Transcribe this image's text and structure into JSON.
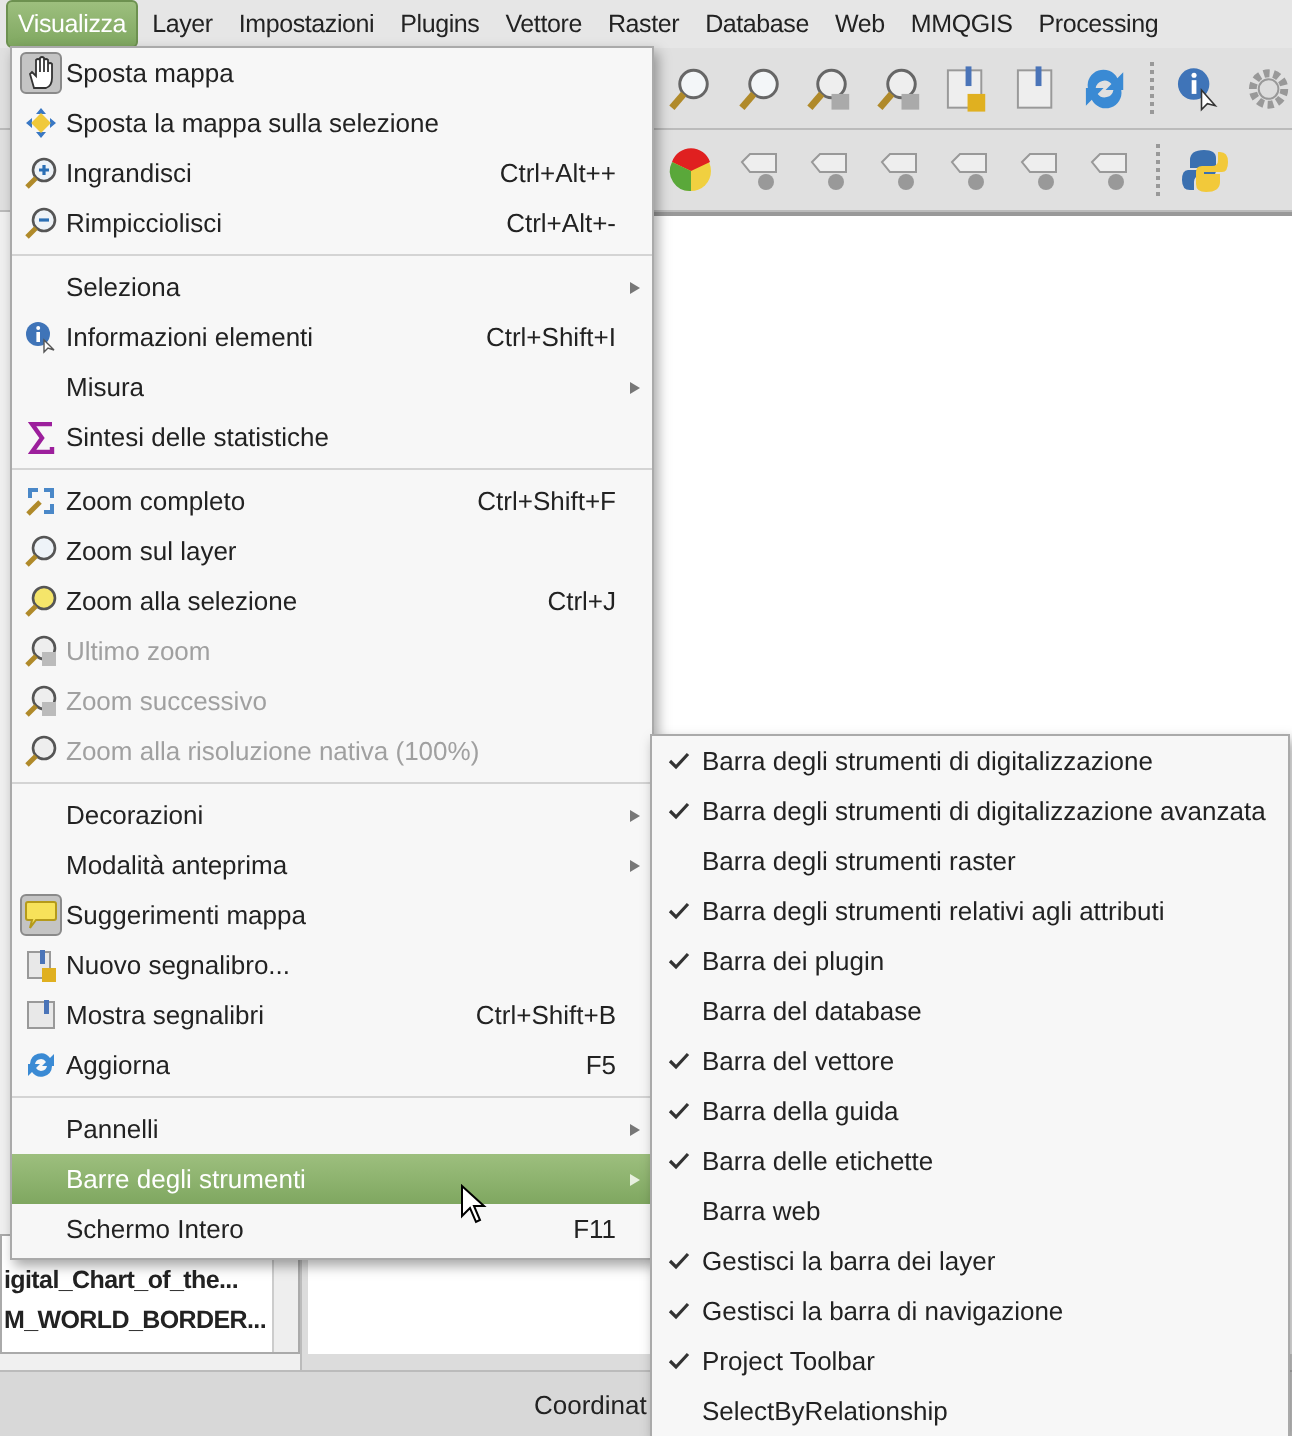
{
  "menubar": [
    {
      "label": "Visualizza",
      "selected": true
    },
    {
      "label": "Layer",
      "selected": false
    },
    {
      "label": "Impostazioni",
      "selected": false
    },
    {
      "label": "Plugins",
      "selected": false
    },
    {
      "label": "Vettore",
      "selected": false
    },
    {
      "label": "Raster",
      "selected": false
    },
    {
      "label": "Database",
      "selected": false
    },
    {
      "label": "Web",
      "selected": false
    },
    {
      "label": "MMQGIS",
      "selected": false
    },
    {
      "label": "Processing",
      "selected": false
    }
  ],
  "layers": [
    {
      "label": "igital_Chart_of_the..."
    },
    {
      "label": "M_WORLD_BORDER..."
    }
  ],
  "status_bar": {
    "label": "Coordinat"
  },
  "menu": {
    "sections": [
      {
        "items": [
          {
            "kind": "action",
            "label": "Sposta mappa",
            "checked": true,
            "disabled": false,
            "selected": false
          },
          {
            "kind": "action",
            "label": "Sposta la mappa sulla selezione",
            "checked": false,
            "disabled": false,
            "selected": false
          },
          {
            "kind": "action",
            "label": "Ingrandisci",
            "shortcut": "Ctrl+Alt++",
            "checked": false,
            "disabled": false,
            "selected": false
          },
          {
            "kind": "action",
            "label": "Rimpicciolisci",
            "shortcut": "Ctrl+Alt+-",
            "checked": false,
            "disabled": false,
            "selected": false
          }
        ]
      },
      {
        "items": [
          {
            "kind": "submenu",
            "label": "Seleziona",
            "checked": false,
            "disabled": false,
            "selected": false
          },
          {
            "kind": "action",
            "label": "Informazioni elementi",
            "shortcut": "Ctrl+Shift+I",
            "checked": false,
            "disabled": false,
            "selected": false
          },
          {
            "kind": "submenu",
            "label": "Misura",
            "checked": false,
            "disabled": false,
            "selected": false
          },
          {
            "kind": "action",
            "label": "Sintesi delle statistiche",
            "checked": false,
            "disabled": false,
            "selected": false
          }
        ]
      },
      {
        "items": [
          {
            "kind": "action",
            "label": "Zoom completo",
            "shortcut": "Ctrl+Shift+F",
            "checked": false,
            "disabled": false,
            "selected": false
          },
          {
            "kind": "action",
            "label": "Zoom sul layer",
            "checked": false,
            "disabled": false,
            "selected": false
          },
          {
            "kind": "action",
            "label": "Zoom alla selezione",
            "shortcut": "Ctrl+J",
            "checked": false,
            "disabled": false,
            "selected": false
          },
          {
            "kind": "action",
            "label": "Ultimo zoom",
            "checked": false,
            "disabled": true,
            "selected": false
          },
          {
            "kind": "action",
            "label": "Zoom successivo",
            "checked": false,
            "disabled": true,
            "selected": false
          },
          {
            "kind": "action",
            "label": "Zoom alla risoluzione nativa (100%)",
            "checked": false,
            "disabled": true,
            "selected": false
          }
        ]
      },
      {
        "items": [
          {
            "kind": "submenu",
            "label": "Decorazioni",
            "checked": false,
            "disabled": false,
            "selected": false
          },
          {
            "kind": "submenu",
            "label": "Modalità anteprima",
            "checked": false,
            "disabled": false,
            "selected": false
          },
          {
            "kind": "action",
            "label": "Suggerimenti mappa",
            "checked": true,
            "disabled": false,
            "selected": false
          },
          {
            "kind": "action",
            "label": "Nuovo segnalibro...",
            "checked": false,
            "disabled": false,
            "selected": false
          },
          {
            "kind": "action",
            "label": "Mostra segnalibri",
            "shortcut": "Ctrl+Shift+B",
            "checked": false,
            "disabled": false,
            "selected": false
          },
          {
            "kind": "action",
            "label": "Aggiorna",
            "shortcut": "F5",
            "checked": false,
            "disabled": false,
            "selected": false
          }
        ]
      },
      {
        "items": [
          {
            "kind": "submenu",
            "label": "Pannelli",
            "checked": false,
            "disabled": false,
            "selected": false
          },
          {
            "kind": "submenu",
            "label": "Barre degli strumenti",
            "checked": false,
            "disabled": false,
            "selected": true
          },
          {
            "kind": "action",
            "label": "Schermo Intero",
            "shortcut": "F11",
            "checked": false,
            "disabled": false,
            "selected": false
          }
        ]
      }
    ]
  },
  "submenu": {
    "items": [
      {
        "label": "Barra degli strumenti di digitalizzazione",
        "checked": true
      },
      {
        "label": "Barra degli strumenti di digitalizzazione avanzata",
        "checked": true
      },
      {
        "label": "Barra degli strumenti raster",
        "checked": false
      },
      {
        "label": "Barra degli strumenti relativi agli attributi",
        "checked": true
      },
      {
        "label": "Barra dei plugin",
        "checked": true
      },
      {
        "label": "Barra del database",
        "checked": false
      },
      {
        "label": "Barra del vettore",
        "checked": true
      },
      {
        "label": "Barra della guida",
        "checked": true
      },
      {
        "label": "Barra delle etichette",
        "checked": true
      },
      {
        "label": "Barra web",
        "checked": false
      },
      {
        "label": "Gestisci la barra dei layer",
        "checked": true
      },
      {
        "label": "Gestisci la barra di navigazione",
        "checked": true
      },
      {
        "label": "Project Toolbar",
        "checked": true
      },
      {
        "label": "SelectByRelationship",
        "checked": false
      }
    ]
  }
}
